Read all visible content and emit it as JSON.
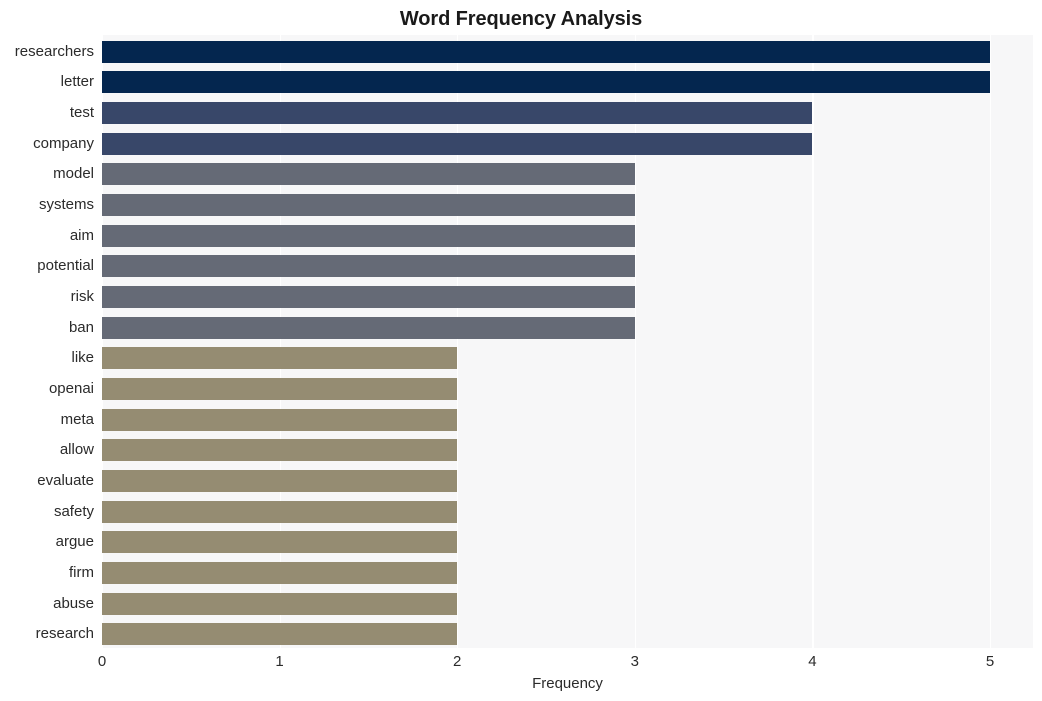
{
  "chart_data": {
    "type": "bar",
    "orientation": "horizontal",
    "title": "Word Frequency Analysis",
    "xlabel": "Frequency",
    "ylabel": "",
    "xlim": [
      0,
      5
    ],
    "xticks": [
      "0",
      "1",
      "2",
      "3",
      "4",
      "5"
    ],
    "xtick_values": [
      0,
      1,
      2,
      3,
      4,
      5
    ],
    "grid": true,
    "grid_axis": "x",
    "legend": "none",
    "categories": [
      "researchers",
      "letter",
      "test",
      "company",
      "model",
      "systems",
      "aim",
      "potential",
      "risk",
      "ban",
      "like",
      "openai",
      "meta",
      "allow",
      "evaluate",
      "safety",
      "argue",
      "firm",
      "abuse",
      "research"
    ],
    "values": [
      5,
      5,
      4,
      4,
      3,
      3,
      3,
      3,
      3,
      3,
      2,
      2,
      2,
      2,
      2,
      2,
      2,
      2,
      2,
      2
    ],
    "bar_colors": [
      "#04264f",
      "#04264f",
      "#384769",
      "#384769",
      "#656a76",
      "#656a76",
      "#656a76",
      "#656a76",
      "#656a76",
      "#656a76",
      "#958c72",
      "#958c72",
      "#958c72",
      "#958c72",
      "#958c72",
      "#958c72",
      "#958c72",
      "#958c72",
      "#958c72",
      "#958c72"
    ],
    "bars": [
      {
        "label": "researchers",
        "value": 5,
        "color": "#04264f"
      },
      {
        "label": "letter",
        "value": 5,
        "color": "#04264f"
      },
      {
        "label": "test",
        "value": 4,
        "color": "#384769"
      },
      {
        "label": "company",
        "value": 4,
        "color": "#384769"
      },
      {
        "label": "model",
        "value": 3,
        "color": "#656a76"
      },
      {
        "label": "systems",
        "value": 3,
        "color": "#656a76"
      },
      {
        "label": "aim",
        "value": 3,
        "color": "#656a76"
      },
      {
        "label": "potential",
        "value": 3,
        "color": "#656a76"
      },
      {
        "label": "risk",
        "value": 3,
        "color": "#656a76"
      },
      {
        "label": "ban",
        "value": 3,
        "color": "#656a76"
      },
      {
        "label": "like",
        "value": 2,
        "color": "#958c72"
      },
      {
        "label": "openai",
        "value": 2,
        "color": "#958c72"
      },
      {
        "label": "meta",
        "value": 2,
        "color": "#958c72"
      },
      {
        "label": "allow",
        "value": 2,
        "color": "#958c72"
      },
      {
        "label": "evaluate",
        "value": 2,
        "color": "#958c72"
      },
      {
        "label": "safety",
        "value": 2,
        "color": "#958c72"
      },
      {
        "label": "argue",
        "value": 2,
        "color": "#958c72"
      },
      {
        "label": "firm",
        "value": 2,
        "color": "#958c72"
      },
      {
        "label": "abuse",
        "value": 2,
        "color": "#958c72"
      },
      {
        "label": "research",
        "value": 2,
        "color": "#958c72"
      }
    ],
    "colors": {
      "plot_background": "#f7f7f8",
      "figure_background": "#ffffff",
      "gridline": "#ffffff",
      "text": "#2b2b2b",
      "title": "#1a1a1a"
    }
  }
}
